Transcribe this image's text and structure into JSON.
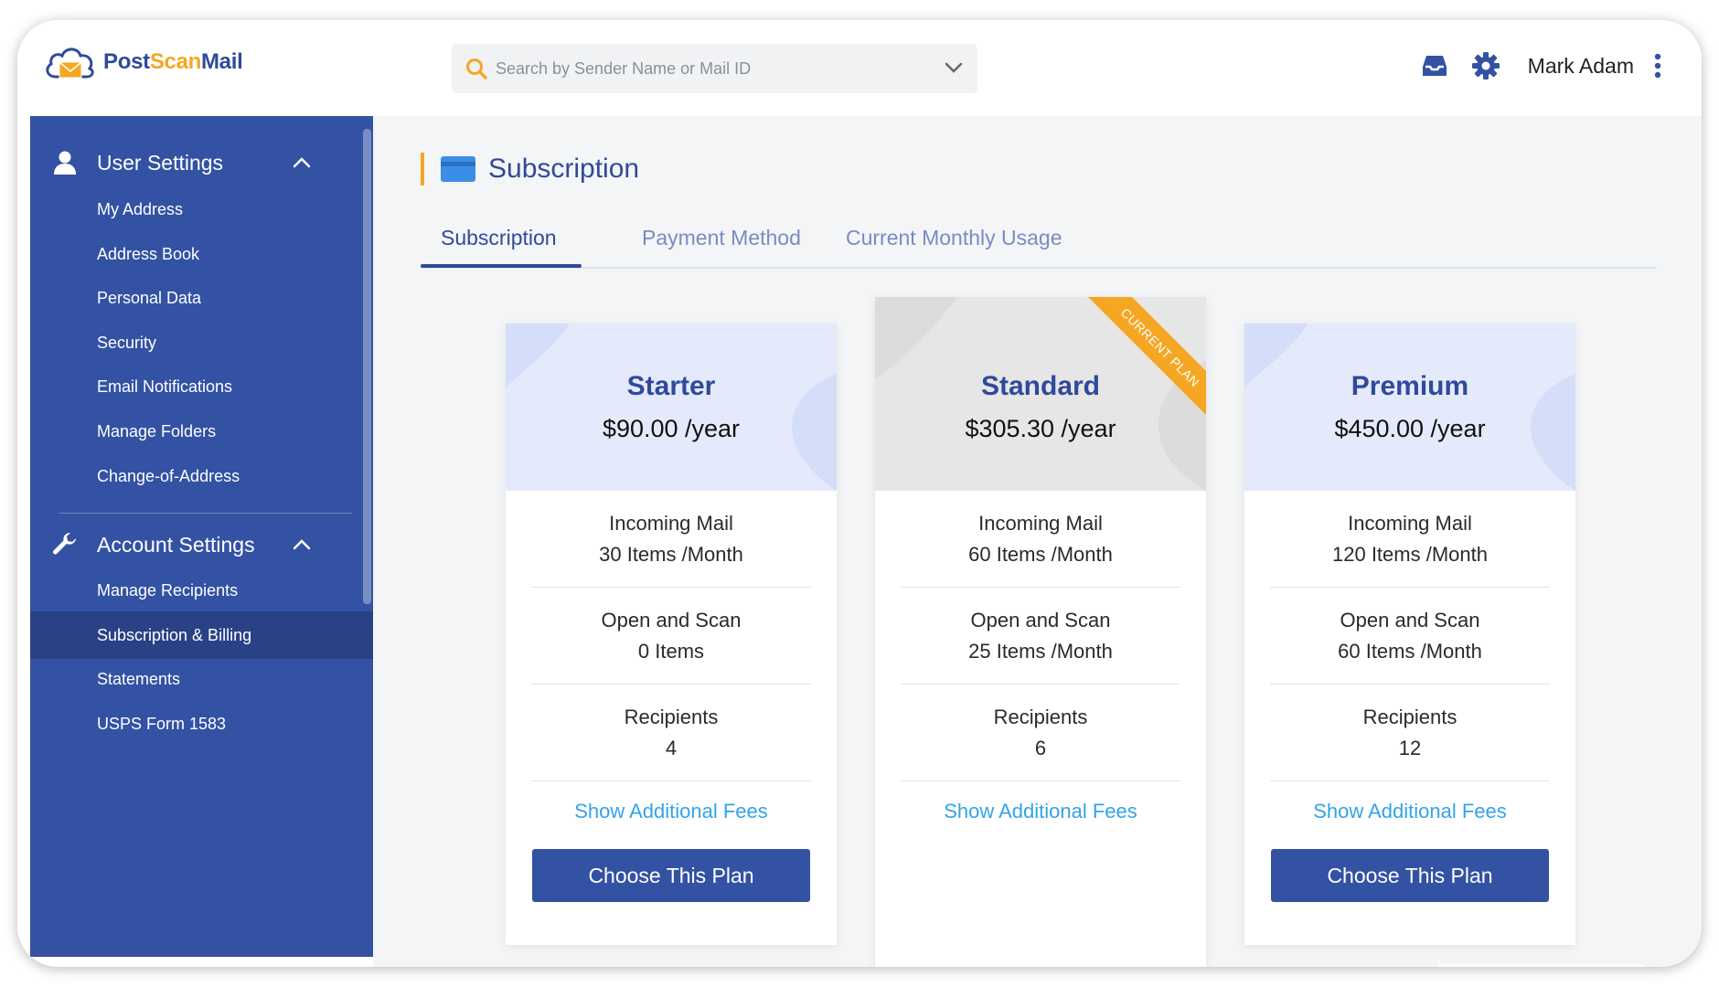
{
  "brand": {
    "name_part1": "Post",
    "name_part2": "Scan",
    "name_part3": "Mail",
    "accent": "#f5a623",
    "primary": "#3352a3"
  },
  "search": {
    "placeholder": "Search by Sender Name or Mail ID",
    "value": ""
  },
  "header": {
    "user_name": "Mark Adam",
    "icons": [
      "inbox-icon",
      "gear-icon",
      "kebab-menu-icon"
    ]
  },
  "sidebar": {
    "user_settings": {
      "label": "User Settings",
      "items": [
        "My Address",
        "Address Book",
        "Personal Data",
        "Security",
        "Email Notifications",
        "Manage Folders",
        "Change-of-Address"
      ]
    },
    "account_settings": {
      "label": "Account Settings",
      "items": [
        "Manage Recipients",
        "Subscription & Billing",
        "Statements",
        "USPS Form 1583"
      ],
      "active_item": "Subscription & Billing"
    }
  },
  "page": {
    "title": "Subscription"
  },
  "tabs": [
    {
      "label": "Subscription",
      "active": true
    },
    {
      "label": "Payment Method",
      "active": false
    },
    {
      "label": "Current Monthly Usage",
      "active": false
    }
  ],
  "plans": [
    {
      "name": "Starter",
      "price": "$90.00 /year",
      "features": [
        {
          "title": "Incoming Mail",
          "value": "30 Items /Month"
        },
        {
          "title": "Open and Scan",
          "value": "0 Items"
        },
        {
          "title": "Recipients",
          "value": "4"
        }
      ],
      "fees_link": "Show Additional Fees",
      "button": "Choose This Plan",
      "current": false
    },
    {
      "name": "Standard",
      "price": "$305.30 /year",
      "features": [
        {
          "title": "Incoming Mail",
          "value": "60 Items /Month"
        },
        {
          "title": "Open and Scan",
          "value": "25 Items /Month"
        },
        {
          "title": "Recipients",
          "value": "6"
        }
      ],
      "fees_link": "Show Additional Fees",
      "ribbon": "CURRENT PLAN",
      "current": true
    },
    {
      "name": "Premium",
      "price": "$450.00 /year",
      "features": [
        {
          "title": "Incoming Mail",
          "value": "120 Items /Month"
        },
        {
          "title": "Open and Scan",
          "value": "60 Items /Month"
        },
        {
          "title": "Recipients",
          "value": "12"
        }
      ],
      "fees_link": "Show Additional Fees",
      "button": "Choose This Plan",
      "current": false
    }
  ]
}
